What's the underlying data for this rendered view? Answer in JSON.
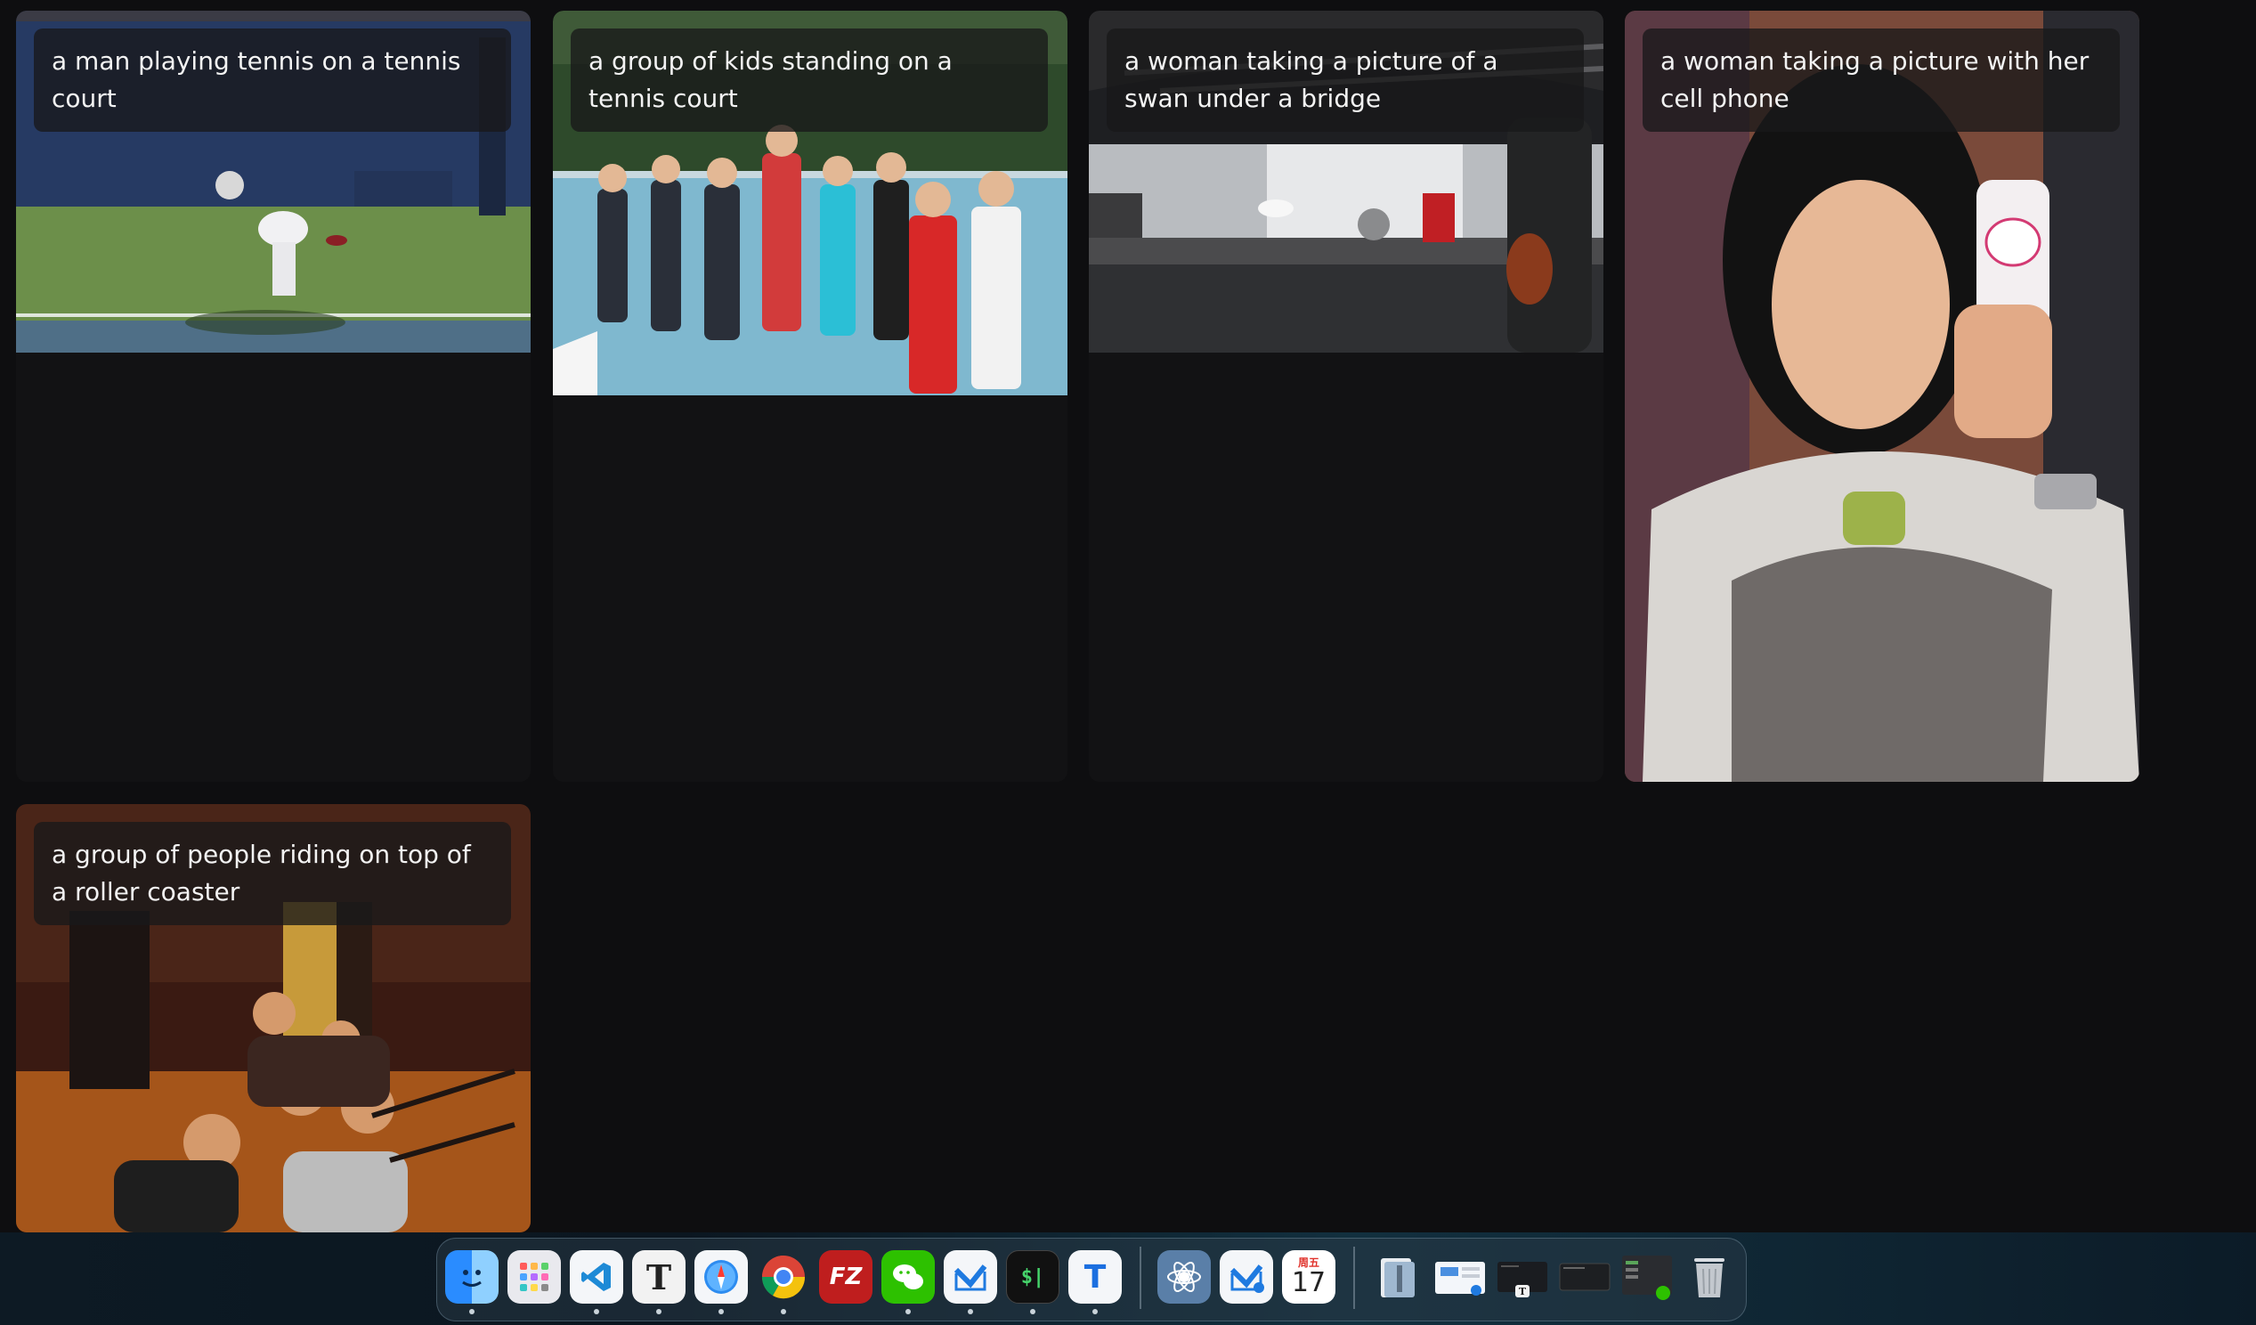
{
  "gallery": {
    "cards": [
      {
        "caption": "a man playing tennis on a tennis court",
        "photo": "tennis-player-photo"
      },
      {
        "caption": "a group of kids standing on a tennis court",
        "photo": "kids-tennis-court-photo"
      },
      {
        "caption": "a woman taking a picture of a swan under a bridge",
        "photo": "swan-bridge-photo"
      },
      {
        "caption": "a woman taking a picture with her cell phone",
        "photo": "woman-cellphone-photo"
      },
      {
        "caption": "a group of people riding on top of a roller coaster",
        "photo": "roller-coaster-photo"
      }
    ]
  },
  "dock": {
    "items": [
      {
        "name": "finder-icon"
      },
      {
        "name": "launchpad-icon"
      },
      {
        "name": "vscode-icon"
      },
      {
        "name": "typora-icon",
        "glyph": "T"
      },
      {
        "name": "safari-icon"
      },
      {
        "name": "chrome-icon"
      },
      {
        "name": "filezilla-icon",
        "glyph": "FZ"
      },
      {
        "name": "wechat-icon"
      },
      {
        "name": "mail-icon"
      },
      {
        "name": "terminal-icon",
        "glyph": "$|"
      },
      {
        "name": "teams-icon",
        "glyph": "T"
      },
      {
        "name": "ai-app-icon"
      },
      {
        "name": "mail-alt-icon"
      },
      {
        "name": "calendar-icon",
        "weekday": "周五",
        "day": "17"
      },
      {
        "name": "archive-icon"
      },
      {
        "name": "preview-window-icon"
      },
      {
        "name": "typora-window-icon"
      },
      {
        "name": "terminal-window-icon"
      },
      {
        "name": "wechat-window-icon"
      },
      {
        "name": "trash-icon"
      }
    ]
  },
  "colors": {
    "background": "#0e0e10",
    "card": "#121214",
    "caption_bg": "#18181a",
    "caption_text": "#f3f3f3"
  }
}
